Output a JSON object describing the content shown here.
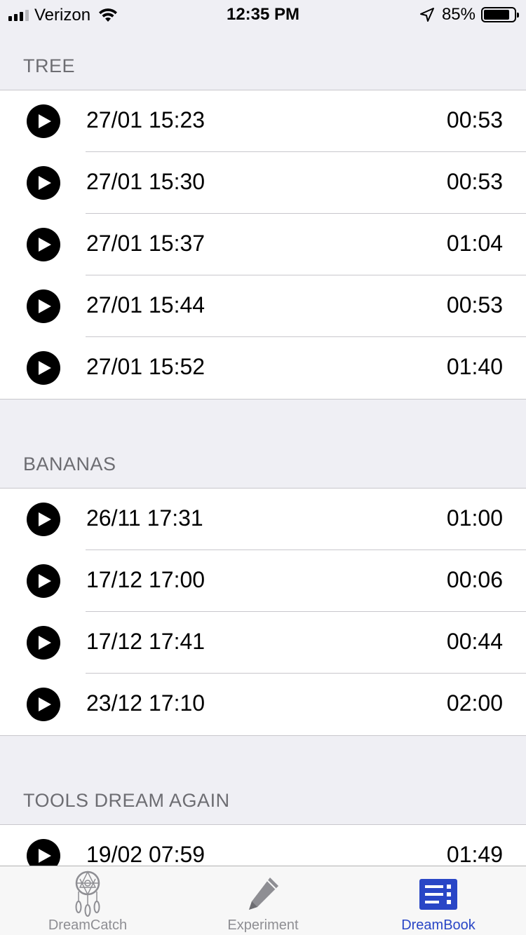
{
  "status_bar": {
    "carrier": "Verizon",
    "time": "12:35 PM",
    "battery_percent": "85%",
    "battery_level": 0.85,
    "icons": [
      "signal-icon",
      "wifi-icon",
      "location-arrow-icon",
      "battery-icon"
    ]
  },
  "sections": [
    {
      "title": "TREE",
      "rows": [
        {
          "date": "27/01 15:23",
          "duration": "00:53"
        },
        {
          "date": "27/01 15:30",
          "duration": "00:53"
        },
        {
          "date": "27/01 15:37",
          "duration": "01:04"
        },
        {
          "date": "27/01 15:44",
          "duration": "00:53"
        },
        {
          "date": "27/01 15:52",
          "duration": "01:40"
        }
      ]
    },
    {
      "title": "BANANAS",
      "rows": [
        {
          "date": "26/11 17:31",
          "duration": "01:00"
        },
        {
          "date": "17/12 17:00",
          "duration": "00:06"
        },
        {
          "date": "17/12 17:41",
          "duration": "00:44"
        },
        {
          "date": "23/12 17:10",
          "duration": "02:00"
        }
      ]
    },
    {
      "title": "TOOLS DREAM AGAIN",
      "rows": [
        {
          "date": "19/02 07:59",
          "duration": "01:49"
        }
      ]
    }
  ],
  "tab_bar": {
    "tabs": [
      {
        "label": "DreamCatch",
        "icon": "dreamcatcher-icon",
        "active": false
      },
      {
        "label": "Experiment",
        "icon": "pen-icon",
        "active": false
      },
      {
        "label": "DreamBook",
        "icon": "book-list-icon",
        "active": true
      }
    ]
  },
  "colors": {
    "background": "#efeff4",
    "accent": "#2946c6",
    "inactive_tab": "#8e8e93",
    "section_title": "#6d6d72"
  }
}
